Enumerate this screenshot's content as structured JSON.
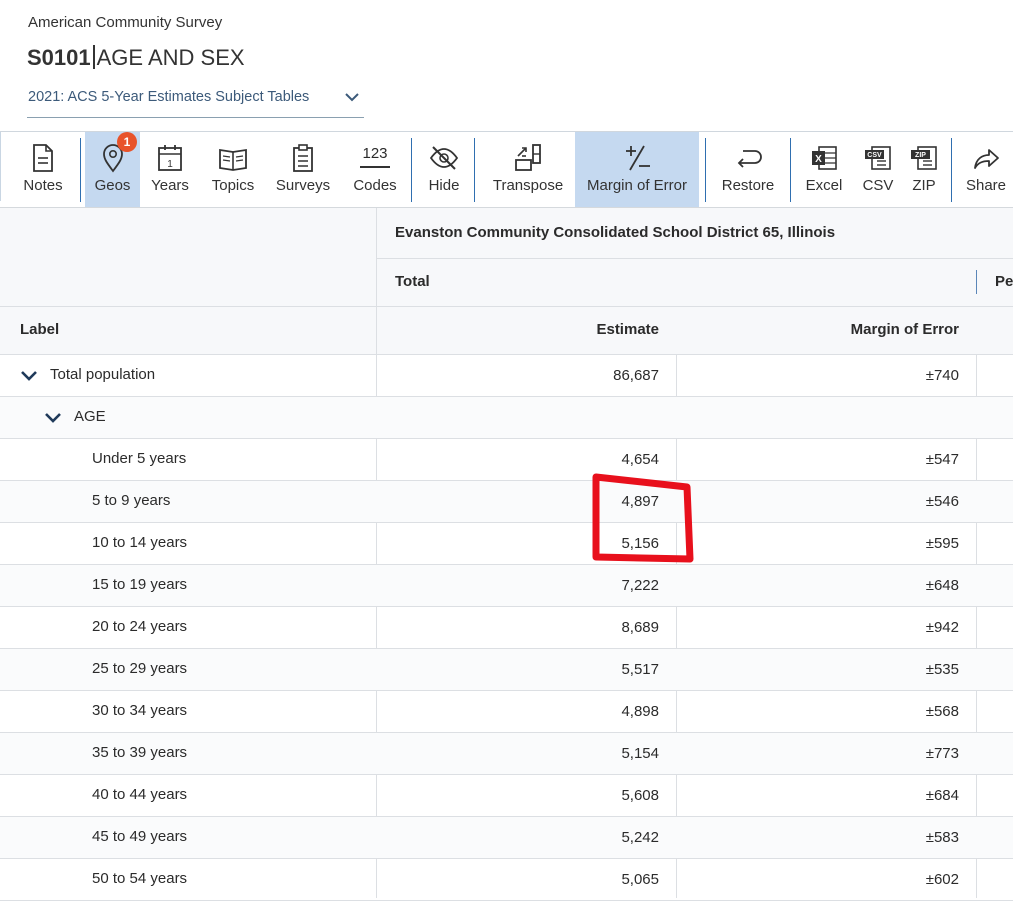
{
  "header": {
    "survey_name": "American Community Survey",
    "table_id": "S0101",
    "table_title": "AGE AND SEX",
    "vintage": "2021: ACS 5-Year Estimates Subject Tables"
  },
  "toolbar": {
    "geos_badge": "1",
    "items": [
      {
        "label": "Notes",
        "icon": "notes-icon"
      },
      {
        "label": "Geos",
        "icon": "map-pin-icon",
        "active": true
      },
      {
        "label": "Years",
        "icon": "calendar-icon"
      },
      {
        "label": "Topics",
        "icon": "book-icon"
      },
      {
        "label": "Surveys",
        "icon": "clipboard-icon"
      },
      {
        "label": "Codes",
        "icon": "codes-icon",
        "icon_text": "123"
      },
      {
        "label": "Hide",
        "icon": "eye-slash-icon"
      },
      {
        "label": "Transpose",
        "icon": "transpose-icon"
      },
      {
        "label": "Margin of Error",
        "icon": "plus-minus-icon",
        "active": true
      },
      {
        "label": "Restore",
        "icon": "restore-icon"
      },
      {
        "label": "Excel",
        "icon": "excel-icon"
      },
      {
        "label": "CSV",
        "icon": "csv-icon"
      },
      {
        "label": "ZIP",
        "icon": "zip-icon"
      },
      {
        "label": "Share",
        "icon": "share-icon"
      }
    ]
  },
  "table": {
    "geography": "Evanston Community Consolidated School District 65, Illinois",
    "group_total": "Total",
    "group_percent_partial": "Pe",
    "col_label": "Label",
    "col_estimate": "Estimate",
    "col_moe": "Margin of Error",
    "rows": [
      {
        "label": "Total population",
        "estimate": "86,687",
        "moe": "±740"
      },
      {
        "label": "AGE",
        "estimate": "",
        "moe": ""
      },
      {
        "label": "Under 5 years",
        "estimate": "4,654",
        "moe": "±547"
      },
      {
        "label": "5 to 9 years",
        "estimate": "4,897",
        "moe": "±546"
      },
      {
        "label": "10 to 14 years",
        "estimate": "5,156",
        "moe": "±595"
      },
      {
        "label": "15 to 19 years",
        "estimate": "7,222",
        "moe": "±648"
      },
      {
        "label": "20 to 24 years",
        "estimate": "8,689",
        "moe": "±942"
      },
      {
        "label": "25 to 29 years",
        "estimate": "5,517",
        "moe": "±535"
      },
      {
        "label": "30 to 34 years",
        "estimate": "4,898",
        "moe": "±568"
      },
      {
        "label": "35 to 39 years",
        "estimate": "5,154",
        "moe": "±773"
      },
      {
        "label": "40 to 44 years",
        "estimate": "5,608",
        "moe": "±684"
      },
      {
        "label": "45 to 49 years",
        "estimate": "5,242",
        "moe": "±583"
      },
      {
        "label": "50 to 54 years",
        "estimate": "5,065",
        "moe": "±602"
      }
    ]
  },
  "colors": {
    "active_tool_bg": "#c5d9f0",
    "badge": "#e8532a",
    "annotation_red": "#e8101c",
    "link_blue": "#3c5a7a"
  }
}
